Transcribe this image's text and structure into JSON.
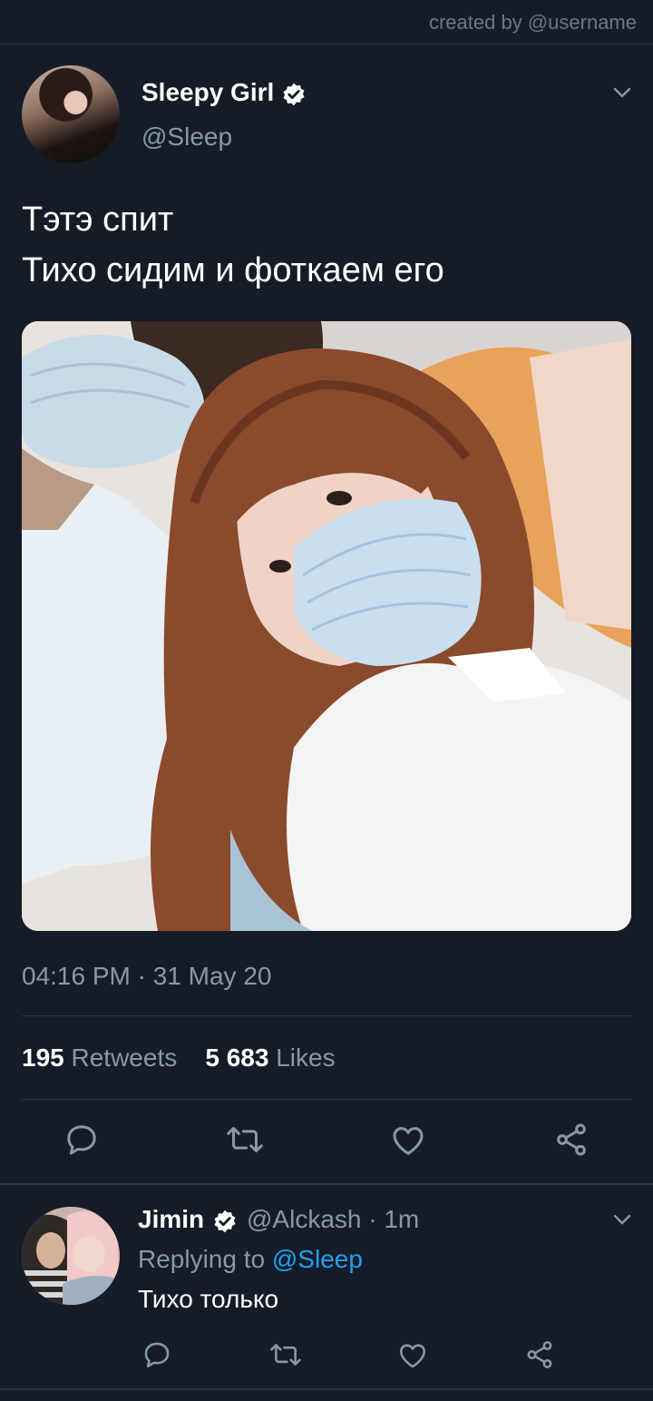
{
  "watermark": "created by @username",
  "tweet": {
    "author": {
      "name": "Sleepy Girl",
      "handle": "@Sleep",
      "verified": true
    },
    "text_lines": [
      "Тэтэ спит",
      "Тихо сидим и фоткаем его"
    ],
    "timestamp": "04:16 PM · 31 May 20",
    "stats": {
      "retweets_count": "195",
      "retweets_label": "Retweets",
      "likes_count": "5 683",
      "likes_label": "Likes"
    },
    "actions": [
      "reply-icon",
      "retweet-icon",
      "like-icon",
      "share-icon"
    ]
  },
  "reply": {
    "author": {
      "name": "Jimin",
      "handle": "@Alckash",
      "verified": true
    },
    "time": "· 1m",
    "replying_to_label": "Replying to",
    "replying_to_handle": "@Sleep",
    "text": "Тихо только",
    "actions": [
      "reply-icon",
      "retweet-icon",
      "like-icon",
      "share-icon"
    ]
  },
  "colors": {
    "background": "#151c28",
    "secondary_text": "#8899a6",
    "accent": "#1da1f2",
    "divider": "#2a3443"
  }
}
